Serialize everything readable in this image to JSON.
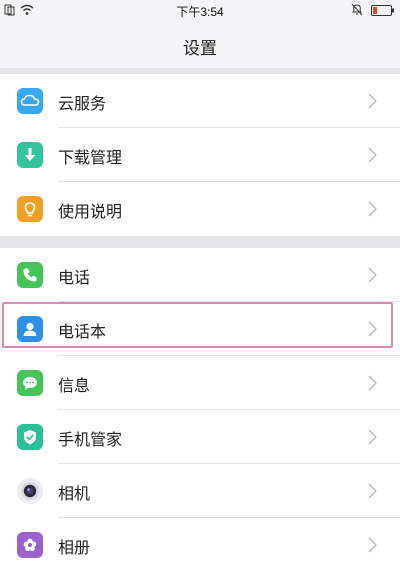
{
  "status_bar": {
    "time": "下午3:54",
    "icons": [
      "sim-icon",
      "wifi-icon",
      "silent-icon",
      "battery-icon"
    ]
  },
  "header": {
    "title": "设置"
  },
  "colors": {
    "icloud": "#38a8f0",
    "download": "#35c4a0",
    "manual": "#f3a02a",
    "phone": "#46c45a",
    "contacts": "#2f8fe0",
    "messages": "#46c45a",
    "manager": "#2bbf9a",
    "camera": "#2b2b36",
    "album": "#9b62cf",
    "highlight": "#d98ab0",
    "battery_level": "#e0463a"
  },
  "settings": {
    "group1": [
      {
        "label": "云服务",
        "icon": "cloud-icon"
      },
      {
        "label": "下载管理",
        "icon": "download-icon"
      },
      {
        "label": "使用说明",
        "icon": "lightbulb-icon"
      }
    ],
    "group2": [
      {
        "label": "电话",
        "icon": "phone-icon"
      },
      {
        "label": "电话本",
        "icon": "contacts-icon"
      },
      {
        "label": "信息",
        "icon": "message-icon"
      },
      {
        "label": "手机管家",
        "icon": "shield-icon"
      },
      {
        "label": "相机",
        "icon": "camera-icon"
      },
      {
        "label": "相册",
        "icon": "album-icon"
      }
    ]
  }
}
